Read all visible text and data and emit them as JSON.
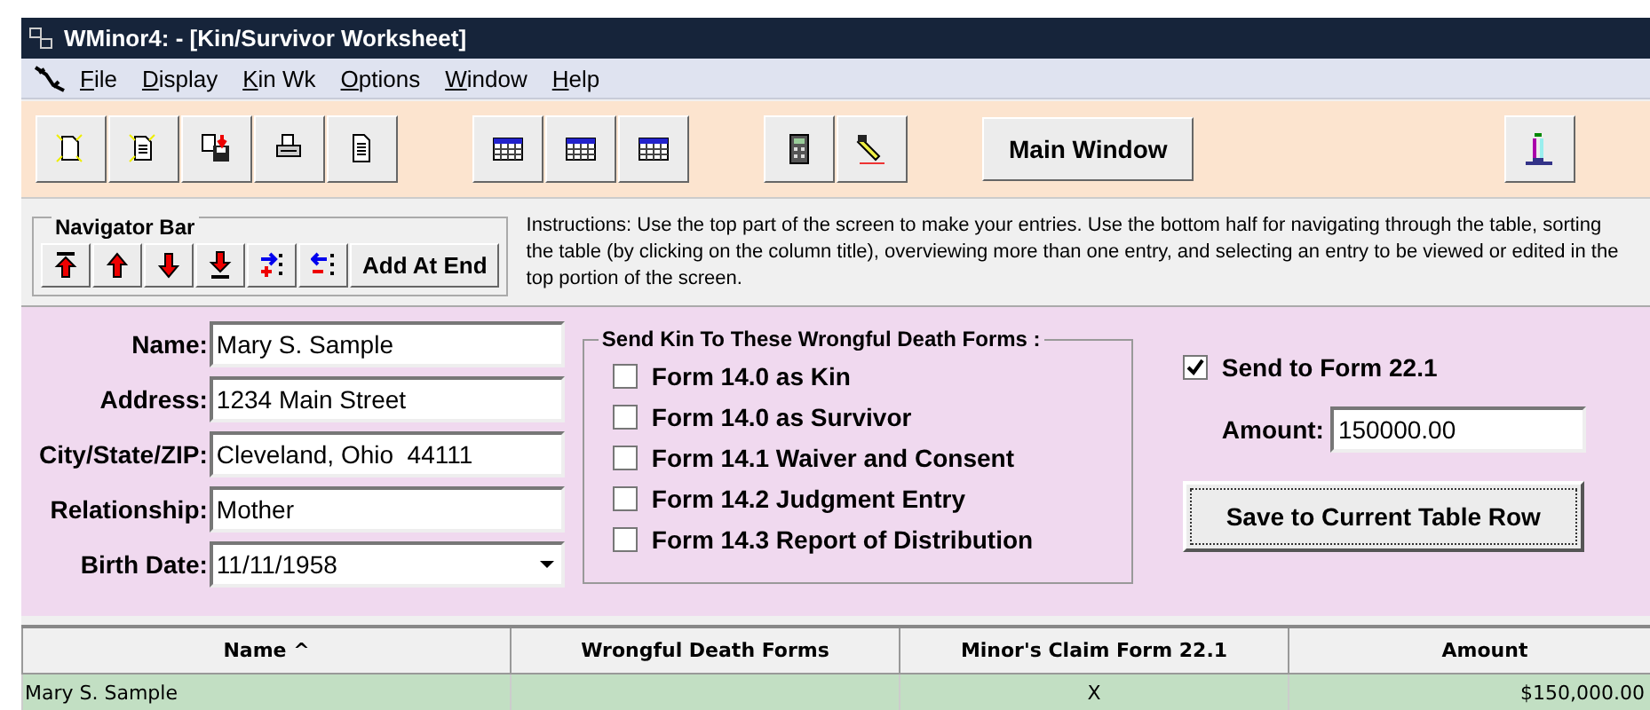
{
  "window": {
    "title": "WMinor4:  - [Kin/Survivor Worksheet]"
  },
  "menu": [
    {
      "label": "File"
    },
    {
      "label": "Display"
    },
    {
      "label": "Kin Wk"
    },
    {
      "label": "Options"
    },
    {
      "label": "Window"
    },
    {
      "label": "Help"
    }
  ],
  "toolbar": {
    "groups": [
      [
        {
          "kind": "new"
        },
        {
          "kind": "newdoc"
        },
        {
          "kind": "save"
        },
        {
          "kind": "print"
        },
        {
          "kind": "doc"
        }
      ],
      [
        {
          "kind": "table"
        },
        {
          "kind": "table"
        },
        {
          "kind": "table"
        }
      ],
      [
        {
          "kind": "calc"
        },
        {
          "kind": "edit"
        }
      ]
    ],
    "main_button": "Main Window"
  },
  "navigator": {
    "title": "Navigator Bar",
    "buttons": [
      {
        "kind": "first"
      },
      {
        "kind": "up"
      },
      {
        "kind": "down"
      },
      {
        "kind": "last"
      },
      {
        "kind": "insert"
      },
      {
        "kind": "delete"
      }
    ],
    "add_button": "Add At End"
  },
  "instructions": "Instructions: Use the top part of the screen to make your entries. Use the bottom half for navigating through the table, sorting the table (by clicking on the column title), overviewing more than one entry, and selecting an entry to be viewed or edited in the top portion of the screen.",
  "fields": [
    {
      "label": "Name:",
      "value": "Mary S. Sample",
      "kind": "text"
    },
    {
      "label": "Address:",
      "value": "1234 Main Street",
      "kind": "text"
    },
    {
      "label": "City/State/ZIP:",
      "value": "Cleveland, Ohio  44111",
      "kind": "text"
    },
    {
      "label": "Relationship:",
      "value": "Mother",
      "kind": "text"
    },
    {
      "label": "Birth Date:",
      "value": "11/11/1958",
      "kind": "dropdown"
    }
  ],
  "forms_group": {
    "title": "Send Kin To These Wrongful Death Forms :",
    "options": [
      {
        "label": "Form 14.0 as Kin",
        "checked": false
      },
      {
        "label": "Form 14.0 as Survivor",
        "checked": false
      },
      {
        "label": "Form 14.1 Waiver and Consent",
        "checked": false
      },
      {
        "label": "Form 14.2 Judgment Entry",
        "checked": false
      },
      {
        "label": "Form 14.3 Report of Distribution",
        "checked": false
      }
    ]
  },
  "send_to_form": {
    "label": "Send to Form 22.1",
    "checked": true
  },
  "amount": {
    "label": "Amount:",
    "value": "150000.00"
  },
  "save_button": "Save to Current Table Row",
  "table": {
    "columns": [
      "Name ^",
      "Wrongful Death Forms",
      "Minor's Claim Form 22.1",
      "Amount"
    ],
    "rows": [
      {
        "cells": [
          "Mary S. Sample",
          "",
          "X",
          "$150,000.00"
        ],
        "selected": true
      }
    ]
  }
}
